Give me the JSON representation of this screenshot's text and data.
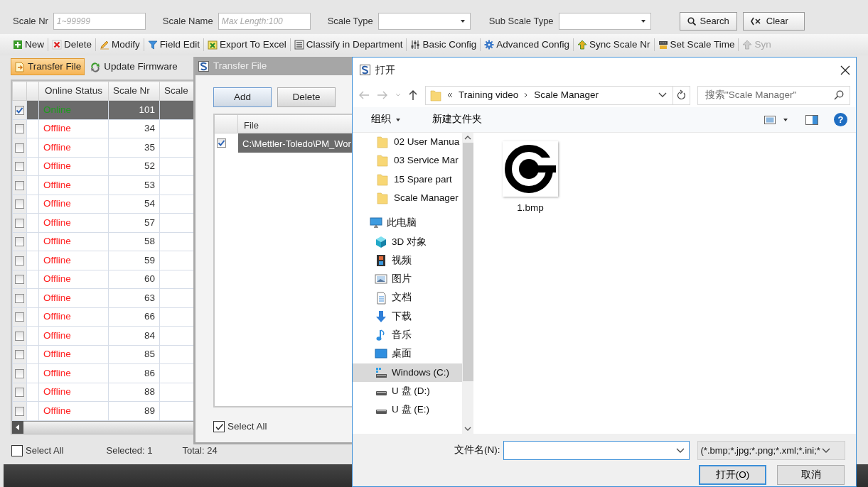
{
  "filter_bar": {
    "fields": [
      {
        "kind": "text",
        "label": "Scale Nr",
        "placeholder": "1~99999"
      },
      {
        "kind": "text",
        "label": "Scale Name",
        "placeholder": "Max Length:100"
      },
      {
        "kind": "select",
        "label": "Scale Type"
      },
      {
        "kind": "select",
        "label": "Sub Scale Type"
      }
    ],
    "buttons": [
      {
        "kind": "search",
        "label": "Search"
      },
      {
        "kind": "clear",
        "label": "Clear"
      }
    ]
  },
  "toolbar": [
    {
      "label": "New",
      "disabled": false
    },
    {
      "label": "Delete",
      "disabled": false
    },
    {
      "label": "Modify",
      "disabled": false
    },
    {
      "label": "Field Edit",
      "disabled": false
    },
    {
      "label": "Export To Excel",
      "disabled": false
    },
    {
      "label": "Classify in Department",
      "disabled": false
    },
    {
      "label": "Basic Config",
      "disabled": false
    },
    {
      "label": "Advanced Config",
      "disabled": false
    },
    {
      "label": "Sync Scale Nr",
      "disabled": false
    },
    {
      "label": "Set Scale Time",
      "disabled": false
    },
    {
      "label": "Syn",
      "disabled": true
    }
  ],
  "tabs": [
    {
      "label": "Transfer File",
      "selected": true
    },
    {
      "label": "Update Firmware",
      "selected": false
    }
  ],
  "table": {
    "columns": [
      "Online Status",
      "Scale Nr",
      "Scale"
    ],
    "rows": [
      {
        "checked": true,
        "selected": true,
        "online": true,
        "status": "Online",
        "scale_nr": "101"
      },
      {
        "checked": false,
        "selected": false,
        "online": false,
        "status": "Offline",
        "scale_nr": "34"
      },
      {
        "checked": false,
        "selected": false,
        "online": false,
        "status": "Offline",
        "scale_nr": "35"
      },
      {
        "checked": false,
        "selected": false,
        "online": false,
        "status": "Offline",
        "scale_nr": "52"
      },
      {
        "checked": false,
        "selected": false,
        "online": false,
        "status": "Offline",
        "scale_nr": "53"
      },
      {
        "checked": false,
        "selected": false,
        "online": false,
        "status": "Offline",
        "scale_nr": "54"
      },
      {
        "checked": false,
        "selected": false,
        "online": false,
        "status": "Offline",
        "scale_nr": "57"
      },
      {
        "checked": false,
        "selected": false,
        "online": false,
        "status": "Offline",
        "scale_nr": "58"
      },
      {
        "checked": false,
        "selected": false,
        "online": false,
        "status": "Offline",
        "scale_nr": "59"
      },
      {
        "checked": false,
        "selected": false,
        "online": false,
        "status": "Offline",
        "scale_nr": "60"
      },
      {
        "checked": false,
        "selected": false,
        "online": false,
        "status": "Offline",
        "scale_nr": "63"
      },
      {
        "checked": false,
        "selected": false,
        "online": false,
        "status": "Offline",
        "scale_nr": "66"
      },
      {
        "checked": false,
        "selected": false,
        "online": false,
        "status": "Offline",
        "scale_nr": "84"
      },
      {
        "checked": false,
        "selected": false,
        "online": false,
        "status": "Offline",
        "scale_nr": "85"
      },
      {
        "checked": false,
        "selected": false,
        "online": false,
        "status": "Offline",
        "scale_nr": "86"
      },
      {
        "checked": false,
        "selected": false,
        "online": false,
        "status": "Offline",
        "scale_nr": "88"
      },
      {
        "checked": false,
        "selected": false,
        "online": false,
        "status": "Offline",
        "scale_nr": "89"
      }
    ]
  },
  "footer": {
    "select_all": {
      "label": "Select All",
      "checked": false
    },
    "selected": "Selected: 1",
    "total": "Total: 24"
  },
  "transfer_dialog": {
    "title": "Transfer File",
    "buttons": [
      "Add",
      "Delete"
    ],
    "columns": [
      "File"
    ],
    "rows": [
      {
        "checked": true,
        "selected": true,
        "file": "C:\\Mettler-Toledo\\PM_Wor"
      }
    ],
    "select_all": {
      "label": "Select All",
      "checked": true
    }
  },
  "open_dialog": {
    "title": "打开",
    "breadcrumb": [
      "Training video",
      "Scale Manager"
    ],
    "search": {
      "placeholder": "搜索\"Scale Manager\""
    },
    "commands": [
      "组织",
      "新建文件夹"
    ],
    "help_button": "?",
    "nav": [
      {
        "kind": "folder",
        "label": "02 User Manua",
        "selected": false
      },
      {
        "kind": "folder",
        "label": "03 Service Mar",
        "selected": false
      },
      {
        "kind": "folder",
        "label": "15 Spare part",
        "selected": false
      },
      {
        "kind": "folder",
        "label": "Scale Manager",
        "selected": false
      },
      {
        "kind": "pc",
        "label": "此电脑",
        "selected": false,
        "children": [
          {
            "kind": "cube",
            "label": "3D 对象",
            "selected": false
          },
          {
            "kind": "video",
            "label": "视频",
            "selected": false
          },
          {
            "kind": "pictures",
            "label": "图片",
            "selected": false
          },
          {
            "kind": "documents",
            "label": "文档",
            "selected": false
          },
          {
            "kind": "downloads",
            "label": "下载",
            "selected": false
          },
          {
            "kind": "music",
            "label": "音乐",
            "selected": false
          },
          {
            "kind": "desktop",
            "label": "桌面",
            "selected": false
          },
          {
            "kind": "system_drive",
            "label": "Windows (C:)",
            "selected": true
          },
          {
            "kind": "drive",
            "label": "U 盘 (D:)",
            "selected": false
          },
          {
            "kind": "drive",
            "label": "U 盘 (E:)",
            "selected": false
          }
        ]
      }
    ],
    "files": [
      {
        "name": "1.bmp"
      }
    ],
    "filename_label": "文件名(N):",
    "file_type": "(*.bmp;*.jpg;*.png;*.xml;*.ini;*",
    "buttons": [
      "打开(O)",
      "取消"
    ]
  }
}
